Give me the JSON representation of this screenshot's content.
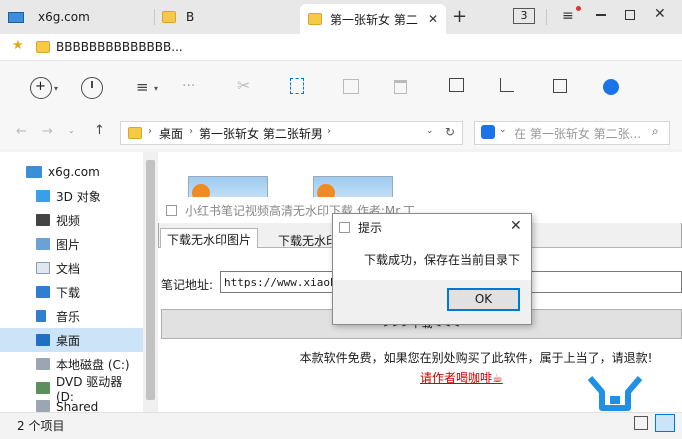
{
  "browser": {
    "tabs": [
      {
        "label": "x6g.com",
        "active": false
      },
      {
        "label": "B",
        "active": false
      },
      {
        "label": "第一张斩女 第二",
        "active": true
      }
    ],
    "tab_count": "3",
    "favorites_item": "BBBBBBBBBBBBBB..."
  },
  "explorer": {
    "breadcrumb": [
      "桌面",
      "第一张斩女 第二张斩男"
    ],
    "search_placeholder": "在 第一张斩女 第二张...",
    "sidebar": [
      {
        "label": "x6g.com",
        "icon": "monitor-icon"
      },
      {
        "label": "3D 对象",
        "icon": "3d-objects-icon"
      },
      {
        "label": "视频",
        "icon": "video-icon"
      },
      {
        "label": "图片",
        "icon": "pictures-icon"
      },
      {
        "label": "文档",
        "icon": "documents-icon"
      },
      {
        "label": "下载",
        "icon": "download-icon"
      },
      {
        "label": "音乐",
        "icon": "music-icon"
      },
      {
        "label": "桌面",
        "icon": "desktop-icon",
        "selected": true
      },
      {
        "label": "本地磁盘 (C:)",
        "icon": "drive-icon"
      },
      {
        "label": "DVD 驱动器 (D:",
        "icon": "dvd-icon"
      },
      {
        "label": "Shared Folders",
        "icon": "shared-folder-icon"
      }
    ],
    "status_text": "2 个项目"
  },
  "app": {
    "title": "小红书笔记视频高清无水印下载 作者:Mr.丁",
    "tabs": [
      "下载无水印图片",
      "下载无水印"
    ],
    "url_label": "笔记地址:",
    "url_value": "https://www.xiaohor                              0270291a8?m_source=pinpai",
    "download_button": ">>>下载<<<",
    "notice": "本款软件免费，如果您在别处购买了此软件，属于上当了，请退款!",
    "coffee_link": "请作者喝咖啡☕"
  },
  "dialog": {
    "title": "提示",
    "message": "下载成功，保存在当前目录下",
    "ok_label": "OK"
  },
  "colors": {
    "accent": "#0078d7",
    "selection": "#cce4f7",
    "link": "#cc0000",
    "folder": "#f7c948"
  }
}
